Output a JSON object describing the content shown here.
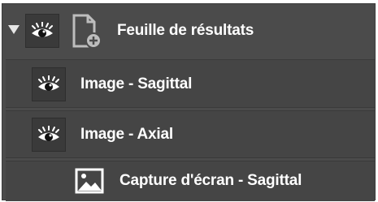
{
  "tree": {
    "header": {
      "label": "Feuille de résultats",
      "expanded": true,
      "icon": "document-add-icon",
      "visibility_icon": "eye-icon"
    },
    "items": [
      {
        "label": "Image - Sagittal",
        "icon": "eye-icon"
      },
      {
        "label": "Image - Axial",
        "icon": "eye-icon"
      },
      {
        "label": "Capture d'écran - Sagittal",
        "icon": "image-icon"
      }
    ]
  },
  "colors": {
    "panel_bg": "#4b4b4b",
    "row_bg": "#454545",
    "button_bg": "#3a3a3a",
    "text": "#ffffff"
  }
}
